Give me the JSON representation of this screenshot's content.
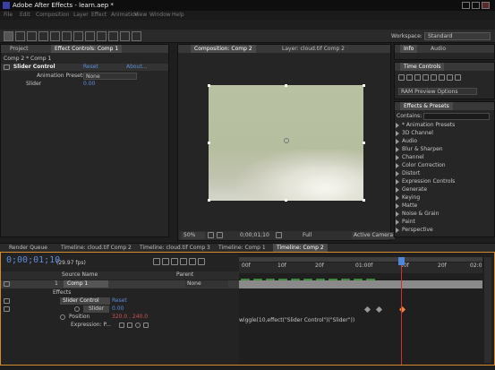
{
  "app": {
    "title": "Adobe After Effects - learn.aep *",
    "menu": [
      "File",
      "Edit",
      "Composition",
      "Layer",
      "Effect",
      "Animation",
      "View",
      "Window",
      "Help"
    ]
  },
  "toolbar": {
    "workspace_label": "Workspace:",
    "workspace_value": "Standard"
  },
  "left_panel": {
    "tabs": [
      "Project",
      "Effect Controls: Comp 1"
    ],
    "breadcrumb": "Comp 2 * Comp 1",
    "effect_name": "Slider Control",
    "reset_label": "Reset",
    "about_label": "About...",
    "presets_label": "Animation Presets:",
    "presets_value": "None",
    "slider_label": "Slider",
    "slider_value": "0.00"
  },
  "center_panel": {
    "tabs": [
      "Composition: Comp 2",
      "Layer: cloud.tif Comp 2"
    ],
    "zoom": "50%",
    "timecode": "0;00;01;10",
    "resolution": "Full",
    "camera": "Active Camera"
  },
  "right_panel": {
    "top_tabs": [
      "Info",
      "Audio"
    ],
    "time_controls_tab": "Time Controls",
    "ram_preview": "RAM Preview Options",
    "effects_tab": "Effects & Presets",
    "contains_label": "Contains:",
    "categories": [
      "* Animation Presets",
      "3D Channel",
      "Audio",
      "Blur & Sharpen",
      "Channel",
      "Color Correction",
      "Distort",
      "Expression Controls",
      "Generate",
      "Keying",
      "Matte",
      "Noise & Grain",
      "Paint",
      "Perspective"
    ]
  },
  "timeline": {
    "tabs": [
      "Render Queue",
      "Timeline: cloud.tif Comp 2",
      "Timeline: cloud.tif Comp 3",
      "Timeline: Comp 1",
      "Timeline: Comp 2"
    ],
    "timecode": "0;00;01;10",
    "fps": "(29.97 fps)",
    "col_source": "Source Name",
    "col_parent": "Parent",
    "layer_num": "1",
    "layer_name": "Comp 1",
    "layer_parent": "None",
    "effects_label": "Effects",
    "effect_name": "Slider Control",
    "reset_label": "Reset",
    "slider_label": "Slider",
    "slider_value": "0.00",
    "position_label": "Position",
    "position_value": "320.0 , 240.0",
    "expression_label": "Expression: P...",
    "expression_text": "wiggle(10,effect(\"Slider Control\")(\"Slider\"))",
    "ruler_labels": [
      "00f",
      "10f",
      "20f",
      "01:00f",
      "10f",
      "20f",
      "02:0"
    ]
  },
  "colors": {
    "accent_orange": "#e8893a",
    "value_blue": "#5d8cd9",
    "comp_bg": "#b9c1a3",
    "cti_blue": "#4f86d9"
  }
}
